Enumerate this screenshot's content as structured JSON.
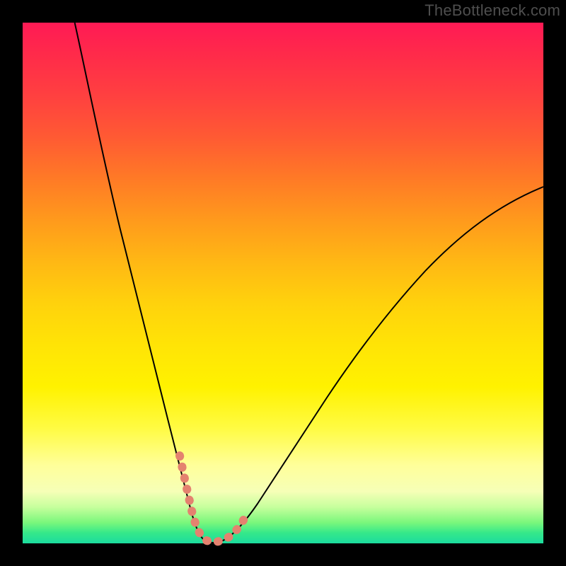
{
  "watermark": {
    "text": "TheBottleneck.com"
  },
  "chart_data": {
    "type": "line",
    "title": "",
    "xlabel": "",
    "ylabel": "",
    "xlim": [
      0,
      100
    ],
    "ylim": [
      0,
      100
    ],
    "grid": false,
    "legend": "none",
    "background_gradient_stops": [
      {
        "pct": 0,
        "color": "#ff1a55"
      },
      {
        "pct": 14,
        "color": "#ff4040"
      },
      {
        "pct": 30,
        "color": "#ff7a26"
      },
      {
        "pct": 46,
        "color": "#ffb814"
      },
      {
        "pct": 62,
        "color": "#ffe406"
      },
      {
        "pct": 78,
        "color": "#fffb44"
      },
      {
        "pct": 90,
        "color": "#f6ffb7"
      },
      {
        "pct": 96,
        "color": "#7af77c"
      },
      {
        "pct": 100,
        "color": "#1bdc9e"
      }
    ],
    "series": [
      {
        "name": "bottleneck-curve",
        "stroke": "#000000",
        "stroke_width": 2,
        "x": [
          10,
          12,
          14,
          16,
          18,
          20,
          22,
          24,
          26,
          27,
          28,
          29,
          30,
          31,
          32,
          33,
          34,
          35,
          37,
          40,
          44,
          50,
          56,
          62,
          70,
          78,
          86,
          94,
          100
        ],
        "y": [
          100,
          90,
          80,
          71,
          62,
          54,
          46,
          38,
          30,
          26,
          22,
          18,
          14,
          10,
          6,
          3,
          1,
          0,
          0,
          2,
          6,
          13,
          21,
          29,
          39,
          48,
          56,
          63,
          68
        ]
      },
      {
        "name": "highlight-peach-segment",
        "stroke": "#e4826f",
        "stroke_width": 10,
        "linecap": "round",
        "dash": "1 14",
        "x": [
          29.5,
          30.5,
          31.5,
          33.0,
          34.5,
          36.5,
          38.5,
          40.0,
          41.0
        ],
        "y": [
          16.0,
          12.0,
          8.0,
          3.0,
          1.0,
          0.5,
          1.0,
          2.5,
          4.0
        ]
      }
    ]
  }
}
